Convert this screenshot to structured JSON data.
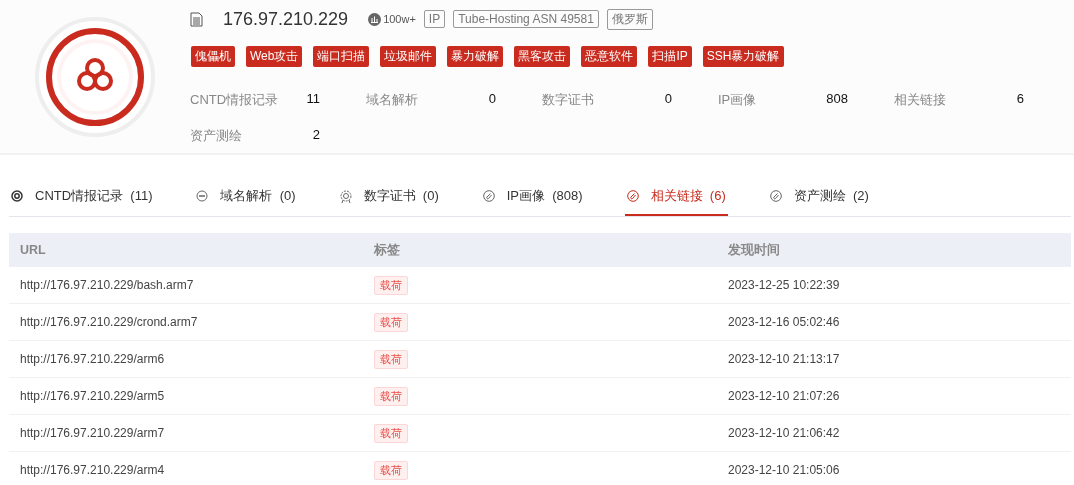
{
  "header": {
    "ip": "176.97.210.229",
    "popularity": "100w+",
    "badges": [
      "IP",
      "Tube-Hosting ASN 49581",
      "俄罗斯"
    ],
    "threat_tags": [
      "傀儡机",
      "Web攻击",
      "端口扫描",
      "垃圾邮件",
      "暴力破解",
      "黑客攻击",
      "恶意软件",
      "扫描IP",
      "SSH暴力破解"
    ],
    "stats": [
      {
        "label": "CNTD情报记录",
        "value": "11"
      },
      {
        "label": "域名解析",
        "value": "0"
      },
      {
        "label": "数字证书",
        "value": "0"
      },
      {
        "label": "IP画像",
        "value": "808"
      },
      {
        "label": "相关链接",
        "value": "6"
      },
      {
        "label": "资产测绘",
        "value": "2"
      }
    ]
  },
  "tabs": [
    {
      "label": "CNTD情报记录",
      "count": "(11)",
      "kind": "radar",
      "selected": false
    },
    {
      "label": "域名解析",
      "count": "(0)",
      "kind": "domain",
      "selected": false
    },
    {
      "label": "数字证书",
      "count": "(0)",
      "kind": "cert",
      "selected": false
    },
    {
      "label": "IP画像",
      "count": "(808)",
      "kind": "link",
      "selected": false
    },
    {
      "label": "相关链接",
      "count": "(6)",
      "kind": "link",
      "selected": true
    },
    {
      "label": "资产测绘",
      "count": "(2)",
      "kind": "link",
      "selected": false
    }
  ],
  "table": {
    "columns": [
      "URL",
      "标签",
      "发现时间"
    ],
    "rows": [
      {
        "url": "http://176.97.210.229/bash.arm7",
        "tag": "载荷",
        "time": "2023-12-25 10:22:39"
      },
      {
        "url": "http://176.97.210.229/crond.arm7",
        "tag": "载荷",
        "time": "2023-12-16 05:02:46"
      },
      {
        "url": "http://176.97.210.229/arm6",
        "tag": "载荷",
        "time": "2023-12-10 21:13:17"
      },
      {
        "url": "http://176.97.210.229/arm5",
        "tag": "载荷",
        "time": "2023-12-10 21:07:26"
      },
      {
        "url": "http://176.97.210.229/arm7",
        "tag": "载荷",
        "time": "2023-12-10 21:06:42"
      },
      {
        "url": "http://176.97.210.229/arm4",
        "tag": "载荷",
        "time": "2023-12-10 21:05:06"
      }
    ]
  }
}
